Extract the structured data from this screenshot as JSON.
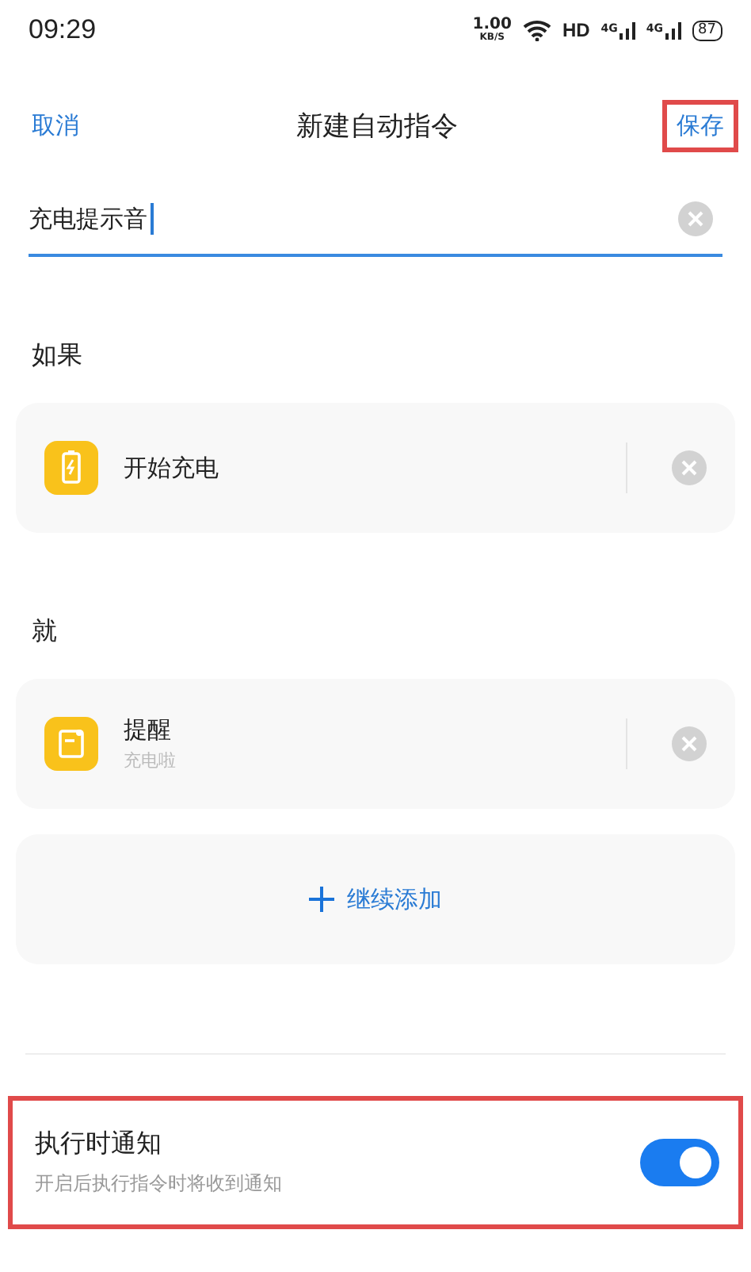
{
  "status_bar": {
    "time": "09:29",
    "speed": "1.00",
    "speed_unit": "KB/S",
    "hd": "HD",
    "signals": [
      "4G",
      "4G"
    ],
    "battery": "87"
  },
  "header": {
    "cancel": "取消",
    "title": "新建自动指令",
    "save": {
      "label": "保存",
      "highlighted": true
    }
  },
  "name_field": {
    "value": "充电提示音"
  },
  "sections": [
    {
      "heading": "如果",
      "items": [
        {
          "kind": "charging",
          "title": "开始充电"
        }
      ]
    },
    {
      "heading": "就",
      "items": [
        {
          "kind": "reminder",
          "title": "提醒",
          "subtitle": "充电啦"
        }
      ]
    }
  ],
  "add_button": "继续添加",
  "notify": {
    "title": "执行时通知",
    "subtitle": "开启后执行指令时将收到通知",
    "on": true,
    "highlighted": true
  }
}
